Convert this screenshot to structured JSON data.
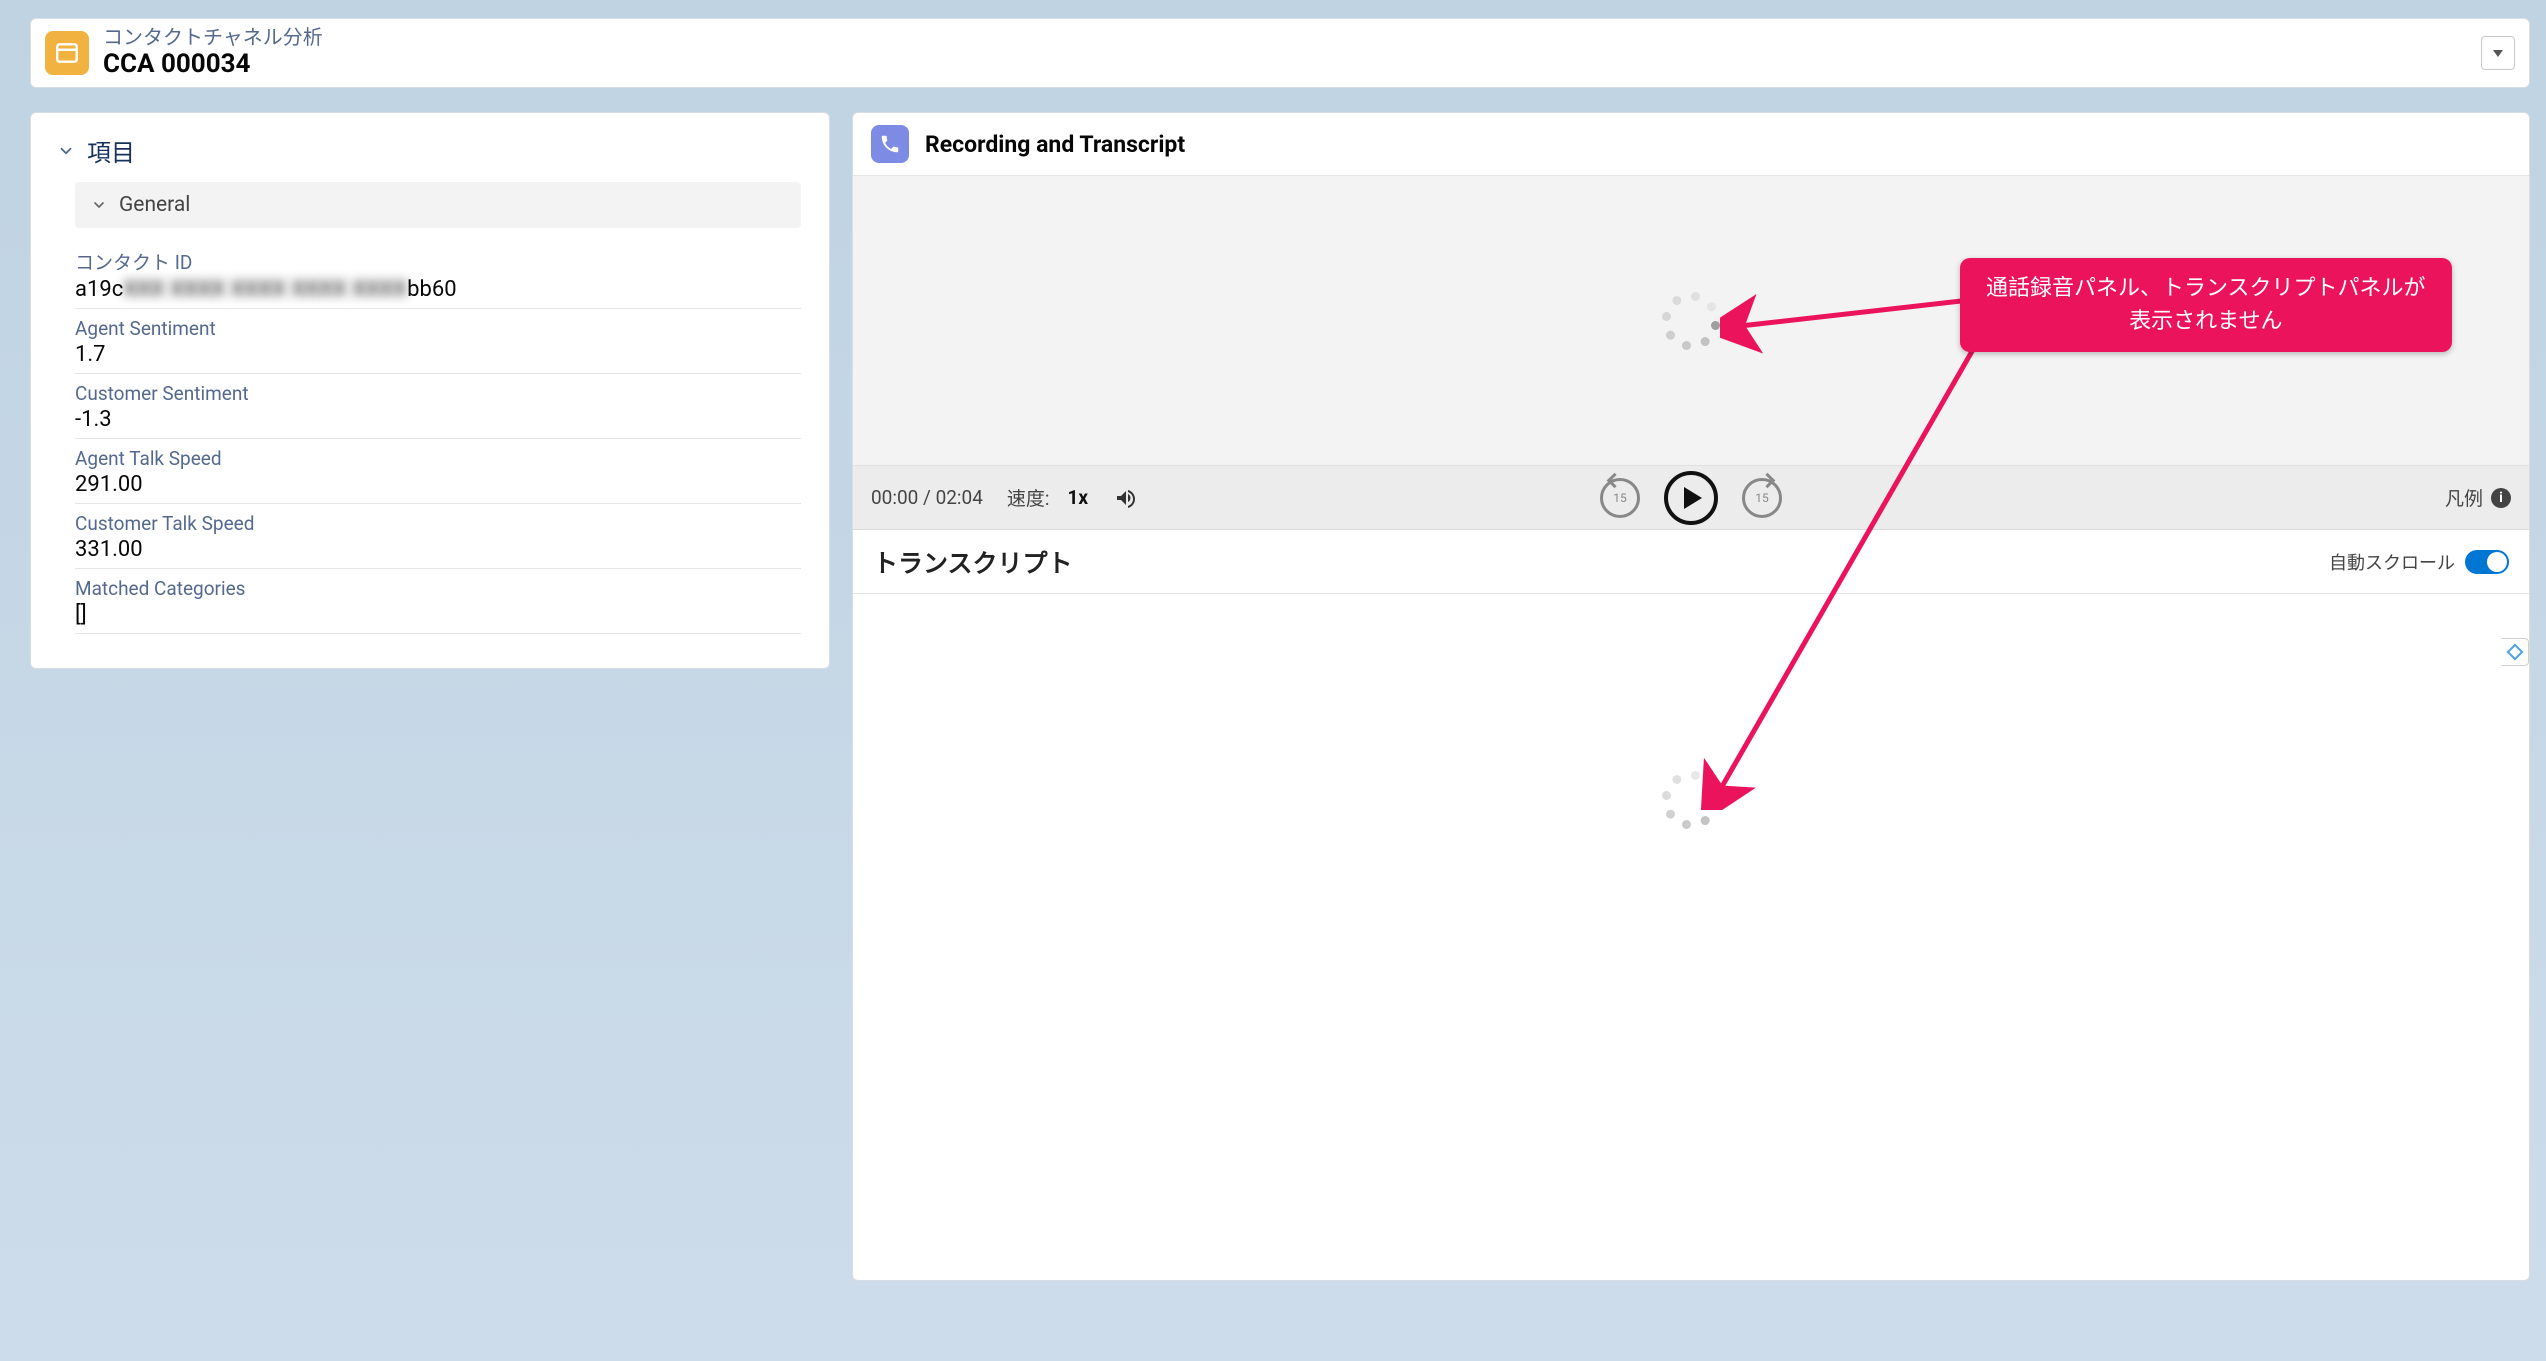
{
  "header": {
    "subtitle": "コンタクトチャネル分析",
    "title": "CCA 000034"
  },
  "left": {
    "section_title": "項目",
    "general_label": "General",
    "fields": {
      "contact_id": {
        "label": "コンタクト ID",
        "prefix": "a19c",
        "masked": "XXX XXXX XXXX XXXX XXXX",
        "suffix": "bb60"
      },
      "agent_sentiment": {
        "label": "Agent Sentiment",
        "value": "1.7"
      },
      "customer_sentiment": {
        "label": "Customer Sentiment",
        "value": "-1.3"
      },
      "agent_talk_speed": {
        "label": "Agent Talk Speed",
        "value": "291.00"
      },
      "customer_talk_speed": {
        "label": "Customer Talk Speed",
        "value": "331.00"
      },
      "matched_categories": {
        "label": "Matched Categories",
        "value": "[]"
      }
    }
  },
  "right": {
    "title": "Recording and Transcript",
    "player": {
      "time": "00:00 / 02:04",
      "speed_label": "速度:",
      "speed_value": "1x",
      "skip_seconds": "15",
      "legend_label": "凡例"
    },
    "transcript": {
      "title": "トランスクリプト",
      "autoscroll_label": "自動スクロール"
    }
  },
  "callout": {
    "line1": "通話録音パネル、トランスクリプトパネルが",
    "line2": "表示されません"
  }
}
